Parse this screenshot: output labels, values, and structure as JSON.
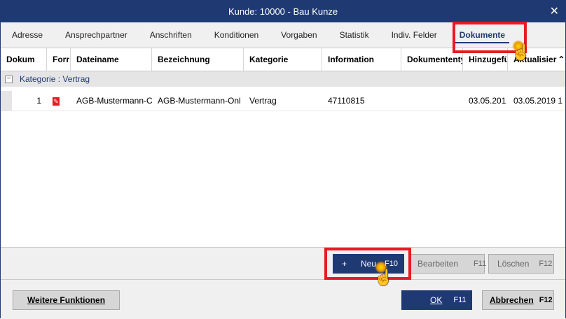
{
  "window": {
    "title": "Kunde: 10000 - Bau Kunze",
    "close_icon": "close-icon"
  },
  "tabs": [
    {
      "label": "Adresse"
    },
    {
      "label": "Ansprechpartner"
    },
    {
      "label": "Anschriften"
    },
    {
      "label": "Konditionen"
    },
    {
      "label": "Vorgaben"
    },
    {
      "label": "Statistik"
    },
    {
      "label": "Indiv. Felder"
    },
    {
      "label": "Dokumente",
      "active": true
    }
  ],
  "grid": {
    "columns": [
      "Dokum",
      "Forr",
      "Dateiname",
      "Bezeichnung",
      "Kategorie",
      "Information",
      "Dokumententy",
      "Hinzugefü",
      "Aktualisier"
    ],
    "group": "Kategorie : Vertrag",
    "rows": [
      {
        "nr": "1",
        "format_icon": "pdf-icon",
        "dateiname": "AGB-Mustermann-C",
        "bezeichnung": "AGB-Mustermann-Onl",
        "kategorie": "Vertrag",
        "information": "47110815",
        "dokumenttyp": "",
        "hinzugefuegt": "03.05.201",
        "aktualisiert": "03.05.2019 1"
      }
    ]
  },
  "toolbar": {
    "neu": {
      "label": "Neu",
      "key": "F10",
      "icon": "+"
    },
    "bearbeiten": {
      "label": "Bearbeiten",
      "key": "F11"
    },
    "loeschen": {
      "label": "Löschen",
      "key": "F12"
    }
  },
  "footer": {
    "weitere": {
      "label": "Weitere Funktionen"
    },
    "ok": {
      "label": "OK",
      "key": "F11"
    },
    "abbrechen": {
      "label": "Abbrechen",
      "key": "F12"
    }
  },
  "colors": {
    "accent": "#1f3a73",
    "highlight": "#e51c24",
    "pdf": "#e31e24"
  }
}
